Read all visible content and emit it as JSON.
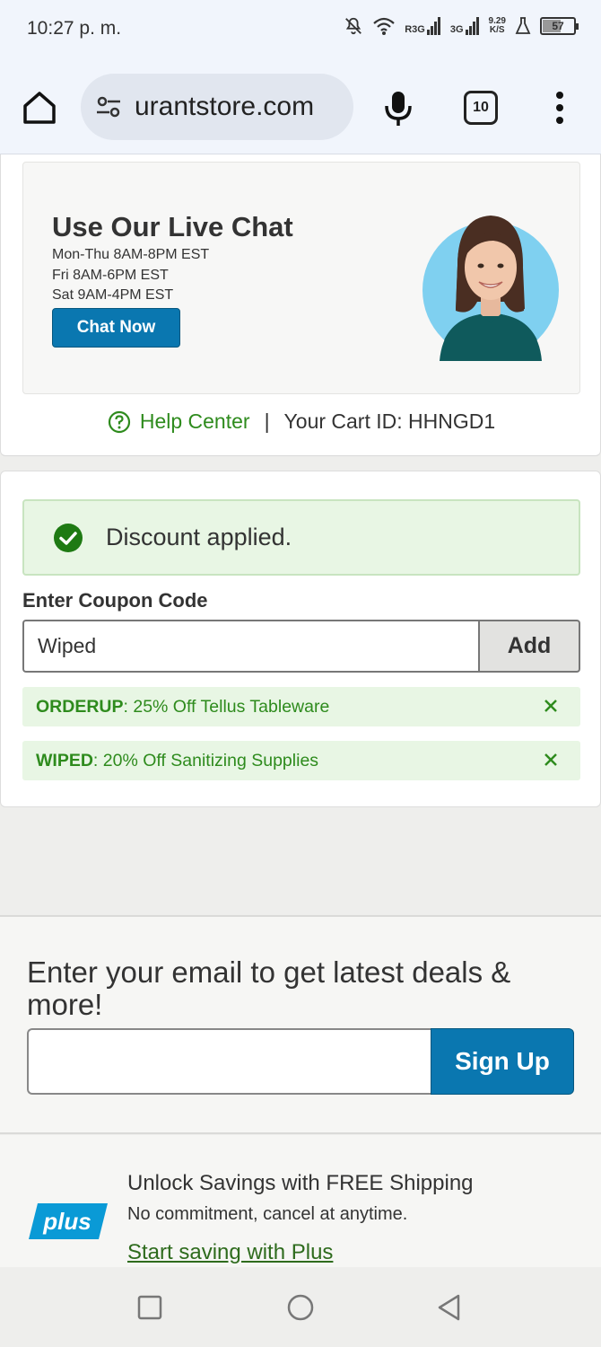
{
  "status_bar": {
    "time": "10:27 p. m.",
    "network1": "R3G",
    "network2": "3G",
    "speed_value": "9.29",
    "speed_unit": "K/S",
    "battery": "57"
  },
  "browser": {
    "url": "urantstore.com",
    "tab_count": "10"
  },
  "live_chat": {
    "title": "Use Our Live Chat",
    "hours": [
      "Mon-Thu 8AM-8PM EST",
      "Fri 8AM-6PM EST",
      "Sat 9AM-4PM EST"
    ],
    "button": "Chat Now"
  },
  "help": {
    "link": "Help Center",
    "separator": "|",
    "cart_id": "Your Cart ID: HHNGD1"
  },
  "coupon": {
    "alert": "Discount applied.",
    "label": "Enter Coupon Code",
    "input_value": "Wiped",
    "add_button": "Add",
    "applied": [
      {
        "code": "ORDERUP",
        "desc": ": 25% Off Tellus Tableware"
      },
      {
        "code": "WIPED",
        "desc": ": 20% Off Sanitizing Supplies"
      }
    ]
  },
  "email_signup": {
    "title": "Enter your email to get latest deals & more!",
    "button": "Sign Up"
  },
  "plus": {
    "logo": "plus",
    "title": "Unlock Savings with FREE Shipping",
    "subtitle": "No commitment, cancel at anytime.",
    "link": "Start saving with Plus"
  },
  "colors": {
    "brand_blue": "#0a77b0",
    "success_green": "#2e8b1d",
    "success_bg": "#e8f6e4"
  }
}
